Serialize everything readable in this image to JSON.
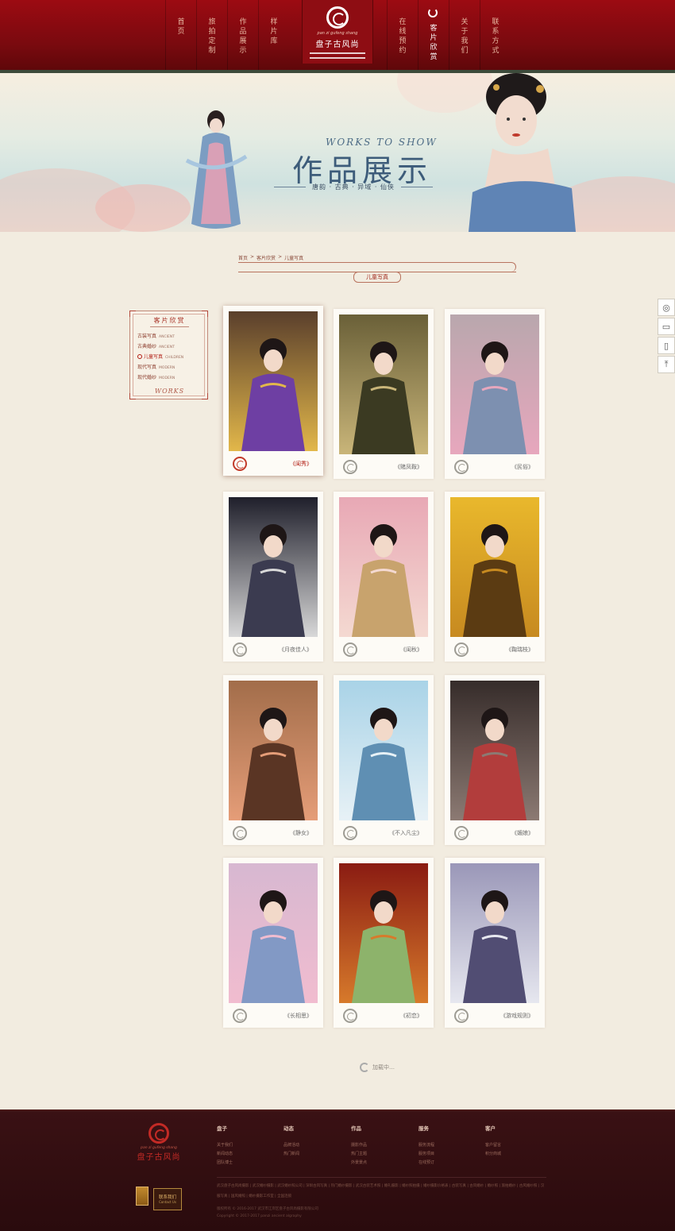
{
  "nav": {
    "items": [
      "首页",
      "旅拍定制",
      "作品展示",
      "样片库",
      "在线预约",
      "客片欣赏",
      "关于我们",
      "联系方式"
    ],
    "active_index": 5,
    "logo_pinyin": "pan zi gufeng shang",
    "logo_text": "盘子古风尚"
  },
  "banner": {
    "title_en": "WORKS TO SHOW",
    "title_cn": "作品展示",
    "tagline": "唐韵 · 古典 · 异域 · 仙侠"
  },
  "breadcrumb": [
    "首页",
    ">",
    "客片欣赏",
    ">",
    "儿童写真"
  ],
  "category_title": "儿童写真",
  "sidebar": {
    "title": "客片欣赏",
    "items": [
      {
        "cn": "古装写真",
        "en": "ANCIENT",
        "active": false
      },
      {
        "cn": "古典婚纱",
        "en": "ANCIENT",
        "active": false
      },
      {
        "cn": "儿童写真",
        "en": "CHILDREN",
        "active": true
      },
      {
        "cn": "现代写真",
        "en": "MODERN",
        "active": false
      },
      {
        "cn": "现代婚纱",
        "en": "MODERN",
        "active": false
      }
    ],
    "footer": "WORKS"
  },
  "gallery": [
    {
      "title": "《闺秀》",
      "palette": [
        "#5a3f2c",
        "#e2b74a",
        "#6e3fa3"
      ]
    },
    {
      "title": "《赌凤鞍》",
      "palette": [
        "#6a6038",
        "#c9b579",
        "#3b3a22"
      ]
    },
    {
      "title": "《民俗》",
      "palette": [
        "#b9a7ad",
        "#e7a7bd",
        "#7d90b0"
      ]
    },
    {
      "title": "《月夜佳人》",
      "palette": [
        "#1f1f2b",
        "#d8d8d8",
        "#3b3b50"
      ]
    },
    {
      "title": "《闺秋》",
      "palette": [
        "#e8a8b5",
        "#f4d9d1",
        "#c8a36d"
      ]
    },
    {
      "title": "《鞠瑞枝》",
      "palette": [
        "#e9b82c",
        "#c78a20",
        "#5b3b12"
      ]
    },
    {
      "title": "《静女》",
      "palette": [
        "#a26d4a",
        "#e59d78",
        "#5a3524"
      ]
    },
    {
      "title": "《不入凡尘》",
      "palette": [
        "#a9d3e7",
        "#e7f1f6",
        "#5f8fb3"
      ]
    },
    {
      "title": "《媚娘》",
      "palette": [
        "#362c2a",
        "#8c7a73",
        "#b23d3c"
      ]
    },
    {
      "title": "《长相思》",
      "palette": [
        "#d7b8d1",
        "#f1bccf",
        "#8299c5"
      ]
    },
    {
      "title": "《初恋》",
      "palette": [
        "#8a1b12",
        "#d77a2b",
        "#8db36b"
      ]
    },
    {
      "title": "《游戏规则》",
      "palette": [
        "#9a97b8",
        "#e6e7ef",
        "#514d73"
      ]
    }
  ],
  "load_more": "加载中…",
  "float_bar": [
    "wechat-icon",
    "message-icon",
    "phone-icon",
    "back-to-top-icon"
  ],
  "footer": {
    "logo_pinyin": "pan zi gufeng shang",
    "logo_text": "盘子古风尚",
    "columns": [
      {
        "title": "盘子",
        "links": [
          "关于我们",
          "新闻动态",
          "团队博士"
        ]
      },
      {
        "title": "动态",
        "links": [
          "品牌活动",
          "热门新闻"
        ]
      },
      {
        "title": "作品",
        "links": [
          "摄影作品",
          "热门主题",
          "外景景点"
        ]
      },
      {
        "title": "服务",
        "links": [
          "服务流程",
          "服务项目",
          "在线预订"
        ]
      },
      {
        "title": "客户",
        "links": [
          "客户留言",
          "积分商城"
        ]
      }
    ],
    "friend_links": "武汉盘子古风尚摄影 | 武汉婚纱摄影 | 武汉婚纱照公司 | 深圳古风写真 | 热门婚纱摄影 | 武汉古装艺术照 | 婚礼摄影 | 婚纱照拍摄 | 婚纱摄影价格表 | 古装写真 | 古风婚纱 | 婚纱照 | 旅拍婚纱 | 古风婚纱照 | 汉服写真 | 国风婚照 | 婚纱摄影工作室 | 全国连锁",
    "copyright_1": "版权所有 © 2016-2017 武汉市江岸区盘子古风尚摄影有限公司",
    "copyright_2": "Copyright © 2017-2017 panzi ancient algraphy",
    "contact_cn": "联系我们",
    "contact_en": "Contact Us"
  }
}
